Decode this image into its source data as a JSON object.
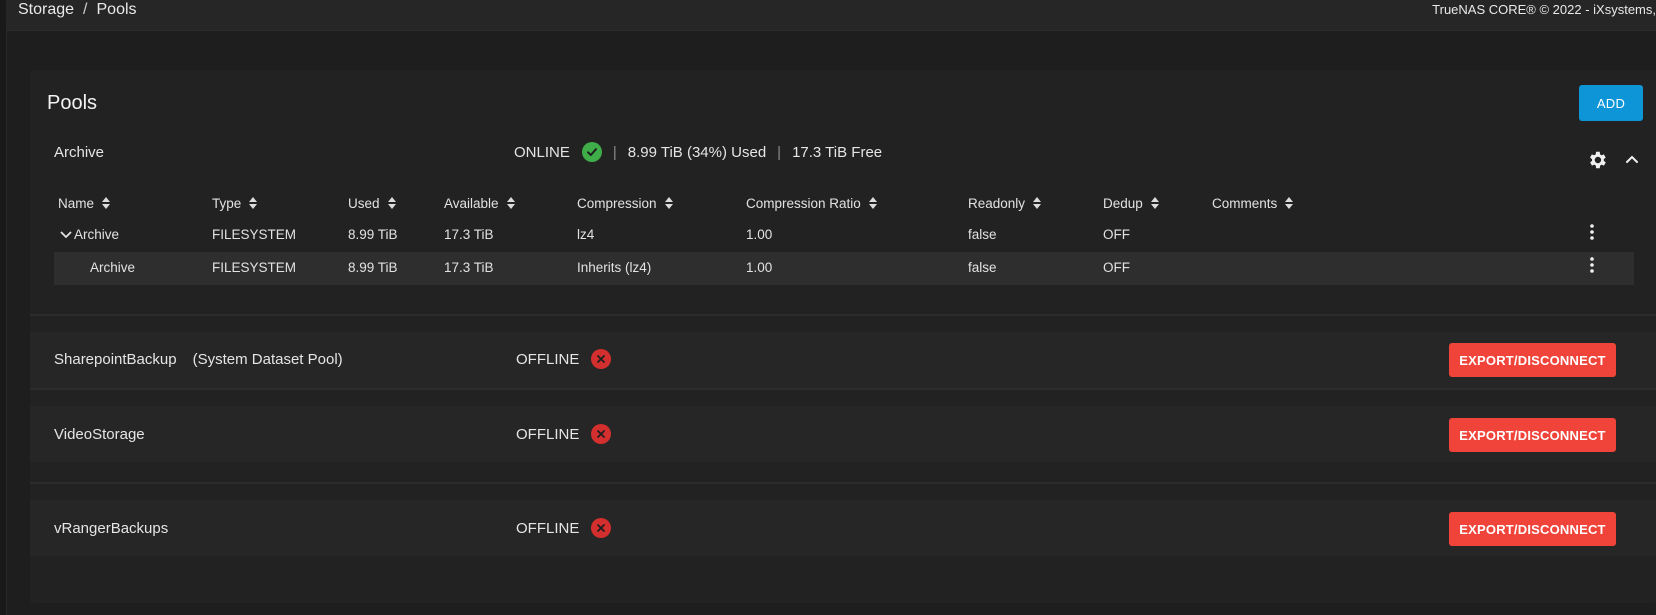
{
  "breadcrumb": {
    "section": "Storage",
    "separator": "/",
    "page": "Pools"
  },
  "copyright": "TrueNAS CORE® © 2022 - iXsystems,",
  "card": {
    "title": "Pools",
    "add_label": "ADD"
  },
  "pools": [
    {
      "name": "Archive",
      "status": "ONLINE",
      "used": "8.99 TiB (34%) Used",
      "free": "17.3 TiB Free",
      "columns": [
        "Name",
        "Type",
        "Used",
        "Available",
        "Compression",
        "Compression Ratio",
        "Readonly",
        "Dedup",
        "Comments"
      ],
      "rows": [
        {
          "name": "Archive",
          "type": "FILESYSTEM",
          "used": "8.99 TiB",
          "available": "17.3 TiB",
          "compression": "lz4",
          "ratio": "1.00",
          "readonly": "false",
          "dedup": "OFF",
          "comments": ""
        },
        {
          "name": "Archive",
          "type": "FILESYSTEM",
          "used": "8.99 TiB",
          "available": "17.3 TiB",
          "compression": "Inherits (lz4)",
          "ratio": "1.00",
          "readonly": "false",
          "dedup": "OFF",
          "comments": ""
        }
      ]
    },
    {
      "name": "SharepointBackup",
      "extra": "(System Dataset Pool)",
      "status": "OFFLINE",
      "action": "EXPORT/DISCONNECT"
    },
    {
      "name": "VideoStorage",
      "status": "OFFLINE",
      "action": "EXPORT/DISCONNECT"
    },
    {
      "name": "vRangerBackups",
      "status": "OFFLINE",
      "action": "EXPORT/DISCONNECT"
    }
  ],
  "colors": {
    "online": "#3fae49",
    "offline": "#d32f2f",
    "add": "#0e95d8",
    "export": "#f0443a"
  }
}
